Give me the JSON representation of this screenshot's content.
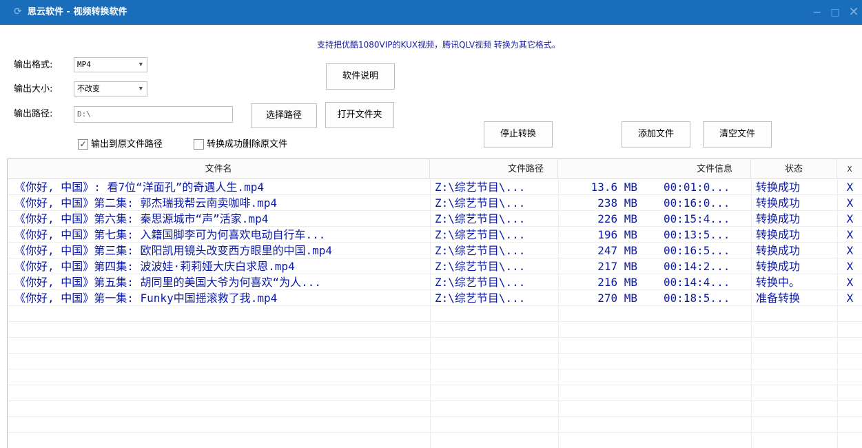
{
  "window": {
    "title": "思云软件 - 视频转换软件",
    "controls": {
      "minimize": "−",
      "maximize": "□",
      "close": "✕"
    }
  },
  "notice": "支持把优酷1080VIP的KUX视频，腾讯QLV视频 转换为其它格式。",
  "form": {
    "format_label": "输出格式:",
    "format_value": "MP4",
    "size_label": "输出大小:",
    "size_value": "不改变",
    "path_label": "输出路径:",
    "path_value": "D:\\",
    "choose_path_button": "选择路径",
    "open_folder_button": "打开文件夹",
    "readme_button": "软件说明",
    "output_to_source_label": "输出到原文件路径",
    "output_to_source_checked": true,
    "delete_source_label": "转换成功删除原文件",
    "delete_source_checked": false
  },
  "actions": {
    "stop_button": "停止转换",
    "add_button": "添加文件",
    "clear_button": "清空文件"
  },
  "table": {
    "headers": {
      "name": "文件名",
      "path": "文件路径",
      "info": "文件信息",
      "status": "状态",
      "remove": "X"
    },
    "rows": [
      {
        "name": "《你好, 中国》: 看7位“洋面孔”的奇遇人生.mp4",
        "path": "Z:\\综艺节目\\...",
        "size": "13.6 MB",
        "duration": "00:01:0...",
        "status": "转换成功",
        "remove": "X"
      },
      {
        "name": "《你好, 中国》第二集: 郭杰瑞我帮云南卖咖啡.mp4",
        "path": "Z:\\综艺节目\\...",
        "size": "238 MB",
        "duration": "00:16:0...",
        "status": "转换成功",
        "remove": "X"
      },
      {
        "name": "《你好, 中国》第六集: 秦思源城市“声”活家.mp4",
        "path": "Z:\\综艺节目\\...",
        "size": "226 MB",
        "duration": "00:15:4...",
        "status": "转换成功",
        "remove": "X"
      },
      {
        "name": "《你好, 中国》第七集: 入籍国脚李可为何喜欢电动自行车...",
        "path": "Z:\\综艺节目\\...",
        "size": "196 MB",
        "duration": "00:13:5...",
        "status": "转换成功",
        "remove": "X"
      },
      {
        "name": "《你好, 中国》第三集: 欧阳凯用镜头改变西方眼里的中国.mp4",
        "path": "Z:\\综艺节目\\...",
        "size": "247 MB",
        "duration": "00:16:5...",
        "status": "转换成功",
        "remove": "X"
      },
      {
        "name": "《你好, 中国》第四集: 波波娃·莉莉娅大庆白求恩.mp4",
        "path": "Z:\\综艺节目\\...",
        "size": "217 MB",
        "duration": "00:14:2...",
        "status": "转换成功",
        "remove": "X"
      },
      {
        "name": "《你好, 中国》第五集: 胡同里的美国大爷为何喜欢“为人...",
        "path": "Z:\\综艺节目\\...",
        "size": "216 MB",
        "duration": "00:14:4...",
        "status": "转换中。",
        "remove": "X"
      },
      {
        "name": "《你好, 中国》第一集: Funky中国摇滚救了我.mp4",
        "path": "Z:\\综艺节目\\...",
        "size": "270 MB",
        "duration": "00:18:5...",
        "status": "准备转换",
        "remove": "X"
      }
    ]
  },
  "colors": {
    "titlebar": "#1a6dbb",
    "notice_text": "#1a1aa0",
    "row_text": "#0c1aa6"
  }
}
